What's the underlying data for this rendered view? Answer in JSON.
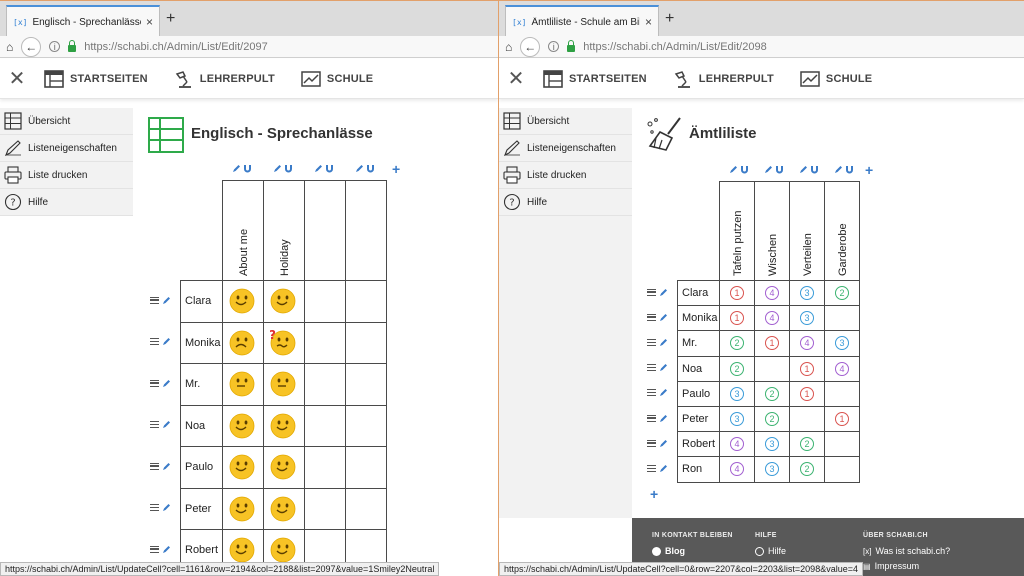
{
  "colors": {
    "accent": "#3a7bc8",
    "tab_accent": "#4a90d9",
    "lock": "#2ea043",
    "footer": "#595959",
    "grid_icon": "#2eaa4a"
  },
  "app_nav": [
    {
      "label": "STARTSEITEN",
      "icon": "home-grid-icon"
    },
    {
      "label": "LEHRERPULT",
      "icon": "desk-lamp-icon"
    },
    {
      "label": "SCHULE",
      "icon": "chart-icon"
    }
  ],
  "sidebar": [
    {
      "label": "Übersicht",
      "icon": "grid-icon"
    },
    {
      "label": "Listeneigenschaften",
      "icon": "pen-icon"
    },
    {
      "label": "Liste drucken",
      "icon": "printer-icon"
    },
    {
      "label": "Hilfe",
      "icon": "help-icon"
    }
  ],
  "left": {
    "tab_title": "Englisch - Sprechanlässe - Sc",
    "url_host": "https://schabi.ch",
    "url_path": "/Admin/List/Edit/2097",
    "title": "Englisch - Sprechanlässe",
    "columns": [
      "About me",
      "Holiday",
      "",
      ""
    ],
    "rows": [
      {
        "name": "Clara",
        "cells": [
          "happy",
          "happy"
        ]
      },
      {
        "name": "Monika",
        "cells": [
          "sad",
          "confused"
        ]
      },
      {
        "name": "Mr.",
        "cells": [
          "neutral",
          "neutral"
        ]
      },
      {
        "name": "Noa",
        "cells": [
          "happy",
          "happy"
        ]
      },
      {
        "name": "Paulo",
        "cells": [
          "happy",
          "happy"
        ]
      },
      {
        "name": "Peter",
        "cells": [
          "happy",
          "happy"
        ]
      },
      {
        "name": "Robert",
        "cells": [
          "happy",
          "happy"
        ]
      }
    ],
    "status": "https://schabi.ch/Admin/List/UpdateCell?cell=1161&row=2194&col=2188&list=2097&value=1Smiley2Neutral"
  },
  "right": {
    "tab_title": "Ämtliliste - Schule am Bildsc",
    "url_host": "https://schabi.ch",
    "url_path": "/Admin/List/Edit/2098",
    "title": "Ämtliliste",
    "columns": [
      "Tafeln putzen",
      "Wischen",
      "Verteilen",
      "Garderobe"
    ],
    "rows": [
      {
        "name": "Clara",
        "cells": [
          "1",
          "4",
          "3",
          "2"
        ]
      },
      {
        "name": "Monika",
        "cells": [
          "1",
          "4",
          "3",
          ""
        ]
      },
      {
        "name": "Mr.",
        "cells": [
          "2",
          "1",
          "4",
          "3"
        ]
      },
      {
        "name": "Noa",
        "cells": [
          "2",
          "",
          "1",
          "4"
        ]
      },
      {
        "name": "Paulo",
        "cells": [
          "3",
          "2",
          "1",
          ""
        ]
      },
      {
        "name": "Peter",
        "cells": [
          "3",
          "2",
          "",
          "1"
        ]
      },
      {
        "name": "Robert",
        "cells": [
          "4",
          "3",
          "2",
          ""
        ]
      },
      {
        "name": "Ron",
        "cells": [
          "4",
          "3",
          "2",
          ""
        ]
      }
    ],
    "badge_colors": {
      "1": "#d9534f",
      "2": "#3cb371",
      "3": "#3a9bd8",
      "4": "#a25fd0"
    },
    "footer": {
      "col1_title": "IN KONTAKT BLEIBEN",
      "col1_item": "Blog",
      "col2_title": "HILFE",
      "col2_item": "Hilfe",
      "col3_title": "ÜBER SCHABI.CH",
      "col3_items": [
        "Was ist schabi.ch?",
        "Impressum"
      ]
    },
    "status": "https://schabi.ch/Admin/List/UpdateCell?cell=0&row=2207&col=2203&list=2098&value=4"
  }
}
